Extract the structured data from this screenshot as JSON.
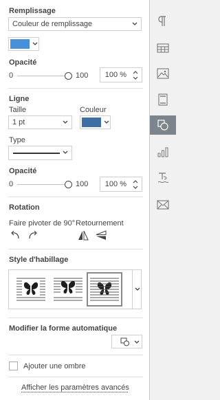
{
  "fill": {
    "title": "Remplissage",
    "type_value": "Couleur de remplissage",
    "color": "#4a8fd9",
    "opacity_label": "Opacité",
    "slider_min": "0",
    "slider_max": "100",
    "opacity_level_percent": 100,
    "opacity_value": "100 %"
  },
  "line": {
    "title": "Ligne",
    "size_label": "Taille",
    "size_value": "1 pt",
    "color_label": "Couleur",
    "color": "#3f6ea5",
    "type_label": "Type",
    "opacity_label": "Opacité",
    "slider_min": "0",
    "slider_max": "100",
    "opacity_level_percent": 100,
    "opacity_value": "100 %"
  },
  "rotation": {
    "title": "Rotation",
    "rotate_label": "Faire pivoter de 90°",
    "flip_label": "Retournement"
  },
  "wrap": {
    "title": "Style d'habillage"
  },
  "autoshape": {
    "title": "Modifier la forme automatique"
  },
  "shadow": {
    "label": "Ajouter une ombre",
    "checked": false
  },
  "advanced_link": "Afficher les paramètres avancés",
  "rail_icons": [
    "paragraph-icon",
    "table-icon",
    "image-icon",
    "header-footer-icon",
    "shape-icon",
    "chart-icon",
    "text-art-icon",
    "mail-merge-icon"
  ],
  "active_rail_icon": "shape-icon"
}
